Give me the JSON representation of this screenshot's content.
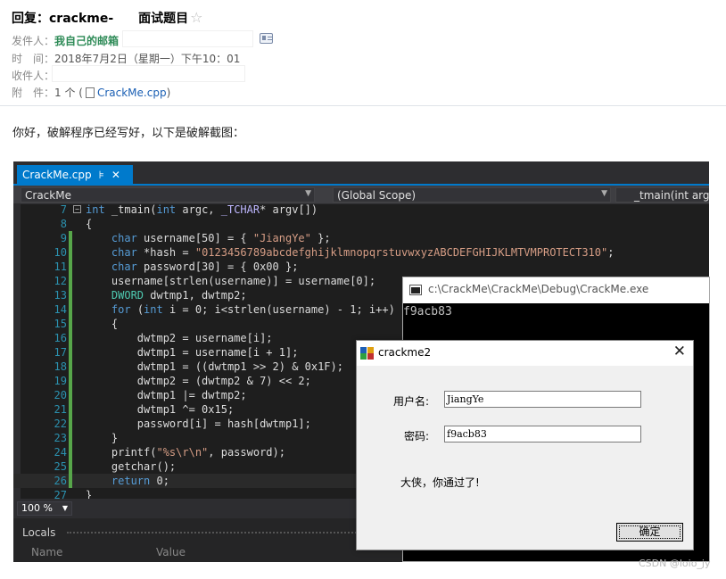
{
  "mail": {
    "subject_prefix": "回复：crackme-",
    "subject_suffix": "面试题目",
    "star": "☆",
    "from_label": "发件人：",
    "from_value": "我自己的邮箱",
    "time_label": "时　间：",
    "time_value": "2018年7月2日（星期一）下午10：01",
    "to_label": "收件人：",
    "attach_label": "附　件：",
    "attach_count": "1 个 (",
    "attach_file": "CrackMe.cpp",
    "attach_close": ")",
    "greeting": "你好，破解程序已经写好，以下是破解截图："
  },
  "ide": {
    "tab_label": "CrackMe.cpp",
    "tab_pin": "⊧",
    "tab_close": "✕",
    "nav_project": "CrackMe",
    "nav_scope": "(Global Scope)",
    "nav_function": "_tmain(int argc",
    "zoom": "100 %",
    "locals_title": "Locals",
    "locals_col_name": "Name",
    "locals_col_value": "Value",
    "code_lines": [
      {
        "n": "7",
        "html": "<span class=\"kw\">int</span> _tmain(<span class=\"kw\">int</span> argc, <span class=\"mac\">_TCHAR</span>* argv[])"
      },
      {
        "n": "8",
        "html": "{"
      },
      {
        "n": "9",
        "html": "    <span class=\"kw\">char</span> username[50] = { <span class=\"str\">\"JiangYe\"</span> };"
      },
      {
        "n": "10",
        "html": "    <span class=\"kw\">char</span> *hash = <span class=\"str\">\"0123456789abcdefghijklmnopqrstuvwxyzABCDEFGHIJKLMTVMPROTECT310\"</span>;"
      },
      {
        "n": "11",
        "html": "    <span class=\"kw\">char</span> password[30] = { 0x00 };"
      },
      {
        "n": "12",
        "html": "    username[strlen(username)] = username[0];"
      },
      {
        "n": "13",
        "html": "    <span class=\"typ\">DWORD</span> dwtmp1, dwtmp2;"
      },
      {
        "n": "14",
        "html": "    <span class=\"kw\">for</span> (<span class=\"kw\">int</span> i = 0; i&lt;strlen(username) - 1; i++)"
      },
      {
        "n": "15",
        "html": "    {"
      },
      {
        "n": "16",
        "html": "        dwtmp2 = username[i];"
      },
      {
        "n": "17",
        "html": "        dwtmp1 = username[i + 1];"
      },
      {
        "n": "18",
        "html": "        dwtmp1 = ((dwtmp1 &gt;&gt; 2) &amp; 0x1F);"
      },
      {
        "n": "19",
        "html": "        dwtmp2 = (dwtmp2 &amp; 7) &lt;&lt; 2;"
      },
      {
        "n": "20",
        "html": "        dwtmp1 |= dwtmp2;"
      },
      {
        "n": "21",
        "html": "        dwtmp1 ^= 0x15;"
      },
      {
        "n": "22",
        "html": "        password[i] = hash[dwtmp1];"
      },
      {
        "n": "23",
        "html": "    }"
      },
      {
        "n": "24",
        "html": "    printf(<span class=\"str\">\"%s\\r\\n\"</span>, password);"
      },
      {
        "n": "25",
        "html": "    getchar();"
      },
      {
        "n": "26",
        "html": "    <span class=\"kw\">return</span> 0;"
      },
      {
        "n": "27",
        "html": "}"
      }
    ]
  },
  "console": {
    "title": "c:\\CrackMe\\CrackMe\\Debug\\CrackMe.exe",
    "output": "f9acb83"
  },
  "dialog": {
    "title": "crackme2",
    "close": "✕",
    "user_label": "用户名:",
    "user_value": "JiangYe",
    "pass_label": "密码:",
    "pass_value": "f9acb83",
    "message": "大侠，你通过了!",
    "ok_label": "确定"
  },
  "watermark": "CSDN @loio_jy"
}
